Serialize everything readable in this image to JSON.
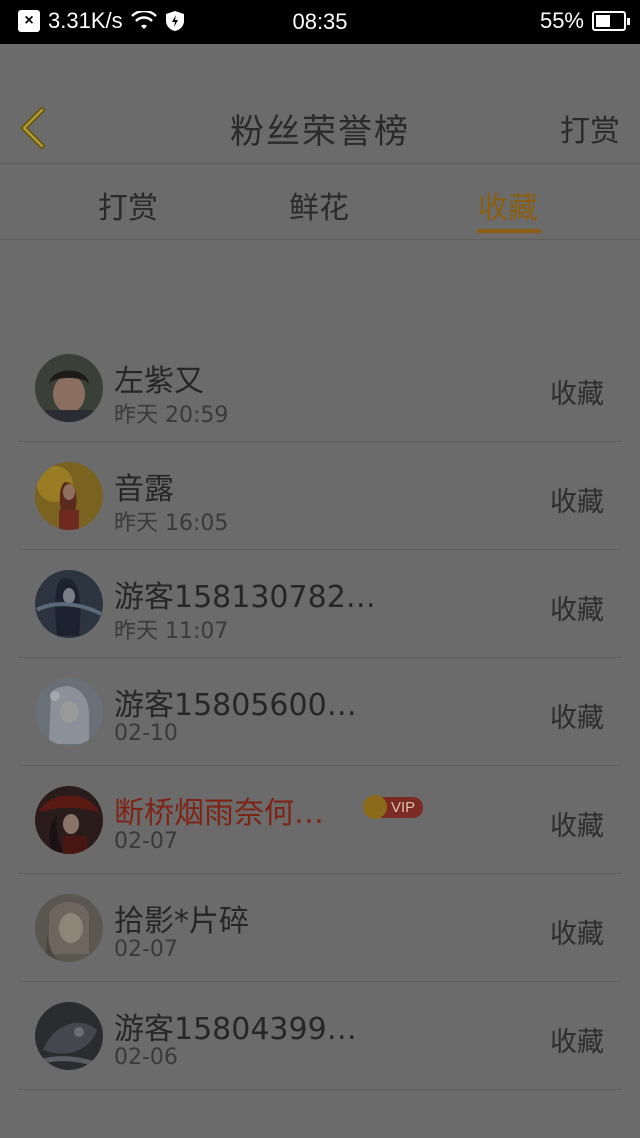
{
  "status_bar": {
    "speed": "3.31K/s",
    "time": "08:35",
    "battery": "55%",
    "battery_level": 0.55,
    "icons": [
      "close-icon",
      "wifi-icon",
      "shield-icon",
      "battery-icon"
    ]
  },
  "header": {
    "title": "粉丝荣誉榜",
    "action": "打赏",
    "back_icon": "chevron-left-icon"
  },
  "tabs": [
    {
      "label": "打赏",
      "active": false
    },
    {
      "label": "鲜花",
      "active": false
    },
    {
      "label": "收藏",
      "active": true
    }
  ],
  "list": [
    {
      "name": "左紫又",
      "time": "昨天 20:59",
      "action": "收藏",
      "vip": false
    },
    {
      "name": "音露",
      "time": "昨天 16:05",
      "action": "收藏",
      "vip": false
    },
    {
      "name": "游客158130782…",
      "time": "昨天 11:07",
      "action": "收藏",
      "vip": false
    },
    {
      "name": "游客15805600…",
      "time": "02-10",
      "action": "收藏",
      "vip": false
    },
    {
      "name": "断桥烟雨奈何…",
      "time": "02-07",
      "action": "收藏",
      "vip": true,
      "badge": "VIP"
    },
    {
      "name": "拾影*片碎",
      "time": "02-07",
      "action": "收藏",
      "vip": false
    },
    {
      "name": "游客15804399…",
      "time": "02-06",
      "action": "收藏",
      "vip": false
    }
  ],
  "colors": {
    "accent": "#8a5f14",
    "vip_name": "#7e2416",
    "overlay_bg": "#6b6b6b"
  }
}
